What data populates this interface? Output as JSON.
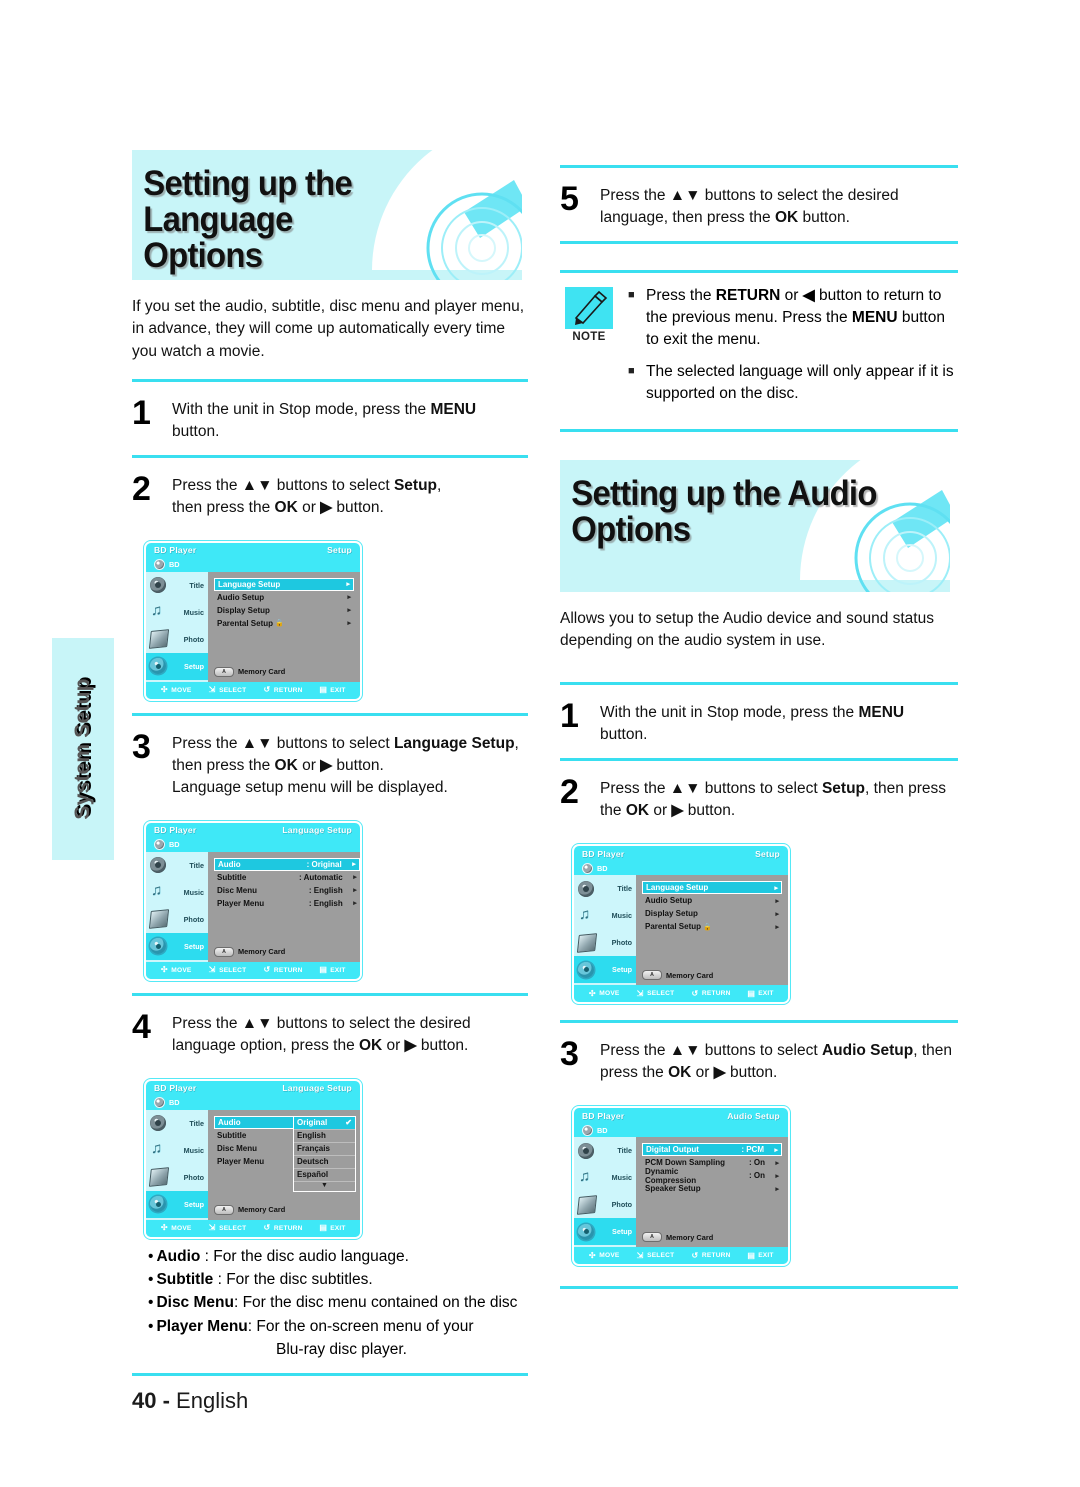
{
  "page": {
    "number": "40",
    "language": "English",
    "side_tab": "System Setup"
  },
  "left_column": {
    "heading_line1": "Setting up the Language",
    "heading_line2": "Options",
    "intro": "If you set the audio, subtitle, disc menu and player menu, in advance, they will come up automatically every time you watch a movie.",
    "steps": [
      {
        "number": "1",
        "line1_a": "With the unit in Stop mode, press the ",
        "line1_b": "MENU",
        "line2": "button."
      },
      {
        "number": "2",
        "line1_a": "Press the ",
        "arrows": "▲▼",
        "line1_b": " buttons to select ",
        "line1_bold": "Setup",
        "line1_c": ",",
        "line2_a": "then press the ",
        "line2_bold1": "OK",
        "line2_b": " or ",
        "line2_bold2": "▶",
        "line2_c": " button."
      },
      {
        "number": "3",
        "line1_a": "Press the ",
        "arrows": "▲▼",
        "line1_b": " buttons to select ",
        "line1_bold": "Language Setup",
        "line1_c": ",",
        "line2_a": "then press the ",
        "line2_bold1": "OK",
        "line2_b": " or ",
        "line2_bold2": "▶",
        "line2_c": " button.",
        "line3": "Language setup menu will be displayed."
      },
      {
        "number": "4",
        "line1_a": "Press the ",
        "arrows": "▲▼",
        "line1_b": " buttons to select the desired",
        "line2_a": "language option, press the ",
        "line2_bold1": "OK",
        "line2_b": " or ",
        "line2_bold2": "▶",
        "line2_c": " button."
      }
    ],
    "definitions": [
      {
        "term": "Audio",
        "sep": " : ",
        "desc": "For the disc audio language."
      },
      {
        "term": "Subtitle",
        "sep": " : ",
        "desc": "For the disc subtitles."
      },
      {
        "term": "Disc Menu",
        "sep": ": ",
        "desc": "For the disc menu contained on the disc"
      },
      {
        "term": "Player Menu",
        "sep": ": ",
        "desc": "For the on-screen menu of your"
      }
    ],
    "definitions_continued": "Blu-ray disc player."
  },
  "right_column": {
    "step5": {
      "number": "5",
      "line1_a": "Press the ",
      "arrows": "▲▼",
      "line1_b": " buttons to select the desired",
      "line2_a": "language, then press the ",
      "line2_bold": "OK",
      "line2_b": " button."
    },
    "note": {
      "label": "NOTE",
      "icon": "pencil-icon",
      "items": [
        {
          "a": "Press the ",
          "b1": "RETURN",
          "c": " or ",
          "b2": "◀",
          "d": " button to return to the previous menu. Press the ",
          "b3": "MENU",
          "e": " button to exit the menu."
        },
        {
          "a": "The selected language will only appear if it is supported on the disc."
        }
      ]
    },
    "heading_line1": "Setting up the Audio",
    "heading_line2": "Options",
    "intro": "Allows you to setup the Audio device and sound status depending on the audio system in use.",
    "steps": [
      {
        "number": "1",
        "line1_a": "With the unit in Stop mode, press the ",
        "line1_b": "MENU",
        "line2": "button."
      },
      {
        "number": "2",
        "line1_a": "Press the ",
        "arrows": "▲▼",
        "line1_b": " buttons to select ",
        "line1_bold": "Setup",
        "line1_c": ", then press",
        "line2_a": "the ",
        "line2_bold1": "OK",
        "line2_b": " or ",
        "line2_bold2": "▶",
        "line2_c": " button."
      },
      {
        "number": "3",
        "line1_a": "Press the ",
        "arrows": "▲▼",
        "line1_b": " buttons to select ",
        "line1_bold": "Audio Setup",
        "line1_c": ", then",
        "line2_a": "press the ",
        "line2_bold1": "OK",
        "line2_b": " or ",
        "line2_bold2": "▶",
        "line2_c": " button."
      }
    ]
  },
  "osd_common": {
    "product": "BD Player",
    "disc_label": "BD",
    "memory_card": "Memory Card",
    "memory_chip_letter": "A",
    "sidebar": [
      {
        "label": "Title",
        "icon": "film-icon"
      },
      {
        "label": "Music",
        "icon": "music-note-icon"
      },
      {
        "label": "Photo",
        "icon": "photo-icon"
      },
      {
        "label": "Setup",
        "icon": "gear-icon"
      }
    ],
    "footbar": [
      {
        "icon": "dpad-icon",
        "label": "MOVE"
      },
      {
        "icon": "select-icon",
        "label": "SELECT"
      },
      {
        "icon": "return-icon",
        "label": "RETURN"
      },
      {
        "icon": "exit-icon",
        "label": "EXIT"
      }
    ]
  },
  "osd_setup": {
    "title": "Setup",
    "rows": [
      {
        "label": "Language Setup",
        "selected": true,
        "lock": false
      },
      {
        "label": "Audio Setup",
        "selected": false,
        "lock": false
      },
      {
        "label": "Display Setup",
        "selected": false,
        "lock": false
      },
      {
        "label": "Parental Setup",
        "selected": false,
        "lock": true
      }
    ]
  },
  "osd_language": {
    "title": "Language Setup",
    "rows": [
      {
        "label": "Audio",
        "value": ": Original",
        "selected": true
      },
      {
        "label": "Subtitle",
        "value": ": Automatic",
        "selected": false
      },
      {
        "label": "Disc Menu",
        "value": ": English",
        "selected": false
      },
      {
        "label": "Player Menu",
        "value": ": English",
        "selected": false
      }
    ]
  },
  "osd_language_dropdown": {
    "title": "Language Setup",
    "rows": [
      {
        "label": "Audio",
        "selected": true
      },
      {
        "label": "Subtitle",
        "selected": false
      },
      {
        "label": "Disc Menu",
        "selected": false
      },
      {
        "label": "Player Menu",
        "selected": false
      }
    ],
    "options": [
      {
        "label": "Original",
        "checked": true
      },
      {
        "label": "English",
        "checked": false
      },
      {
        "label": "Français",
        "checked": false
      },
      {
        "label": "Deutsch",
        "checked": false
      },
      {
        "label": "Español",
        "checked": false
      }
    ],
    "more_indicator": "▼",
    "check_glyph": "✔"
  },
  "osd_audio": {
    "title": "Audio Setup",
    "rows": [
      {
        "label": "Digital Output",
        "value": ": PCM",
        "selected": true
      },
      {
        "label": "PCM Down Sampling",
        "value": ": On",
        "selected": false
      },
      {
        "label": "Dynamic Compression",
        "value": ": On",
        "selected": false
      },
      {
        "label": "Speaker Setup",
        "value": "",
        "selected": false
      }
    ]
  },
  "colors": {
    "accent_cyan": "#39dff0",
    "banner_bg": "#c8f5f8",
    "osd_cyan": "#3fe8f7",
    "osd_panel_gray": "#9d9d9d",
    "osd_select": "#1ec8e0"
  }
}
